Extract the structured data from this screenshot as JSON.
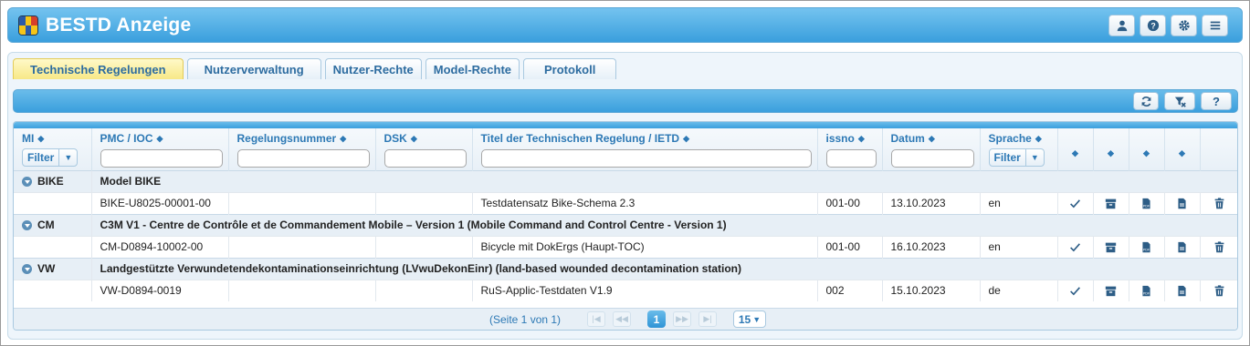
{
  "app": {
    "title": "BESTD Anzeige",
    "logo_colors": [
      "#2b5aa8",
      "#f5c518",
      "#d6402a",
      "#2b5aa8",
      "#f5c518",
      "#d6402a"
    ],
    "header_buttons": [
      {
        "icon": "user-icon"
      },
      {
        "icon": "help-circle-icon"
      },
      {
        "icon": "gear-icon"
      },
      {
        "icon": "menu-icon"
      }
    ]
  },
  "tabs": [
    {
      "label": "Technische Regelungen",
      "active": true
    },
    {
      "label": "Nutzerverwaltung",
      "active": false
    },
    {
      "label": "Nutzer-Rechte",
      "active": false
    },
    {
      "label": "Model-Rechte",
      "active": false
    },
    {
      "label": "Protokoll",
      "active": false
    }
  ],
  "toolbar": {
    "buttons": [
      {
        "icon": "refresh-icon"
      },
      {
        "icon": "clear-filter-icon"
      },
      {
        "icon": "help-icon",
        "label": "?"
      }
    ]
  },
  "grid": {
    "columns": {
      "mi": "MI",
      "pmc": "PMC / IOC",
      "regel": "Regelungsnummer",
      "dsk": "DSK",
      "titel": "Titel der Technischen Regelung / IETD",
      "issno": "issno",
      "datum": "Datum",
      "sprache": "Sprache"
    },
    "filter_label": "Filter",
    "groups": [
      {
        "key": "BIKE",
        "title": "Model BIKE",
        "row": {
          "pmc": "BIKE-U8025-00001-00",
          "regel": "",
          "dsk": "",
          "titel": "Testdatensatz Bike-Schema 2.3",
          "issno": "001-00",
          "datum": "13.10.2023",
          "sprache": "en"
        }
      },
      {
        "key": "CM",
        "title": "C3M V1 - Centre de Contrôle et de Commandement Mobile – Version 1 (Mobile Command and Control Centre - Version 1)",
        "row": {
          "pmc": "CM-D0894-10002-00",
          "regel": "",
          "dsk": "",
          "titel": "Bicycle mit DokErgs (Haupt-TOC)",
          "issno": "001-00",
          "datum": "16.10.2023",
          "sprache": "en"
        }
      },
      {
        "key": "VW",
        "title": "Landgestützte Verwundetendekontaminationseinrichtung (LVwuDekonEinr) (land-based wounded decontamination station)",
        "row": {
          "pmc": "VW-D0894-0019",
          "regel": "",
          "dsk": "",
          "titel": "RuS-Applic-Testdaten V1.9",
          "issno": "002",
          "datum": "15.10.2023",
          "sprache": "de"
        }
      }
    ],
    "row_action_icons": [
      "check-icon",
      "archive-icon",
      "pdf-file-icon",
      "document-icon",
      "trash-icon"
    ]
  },
  "pager": {
    "info": "(Seite 1 von 1)",
    "current_page": "1",
    "page_size": "15"
  }
}
